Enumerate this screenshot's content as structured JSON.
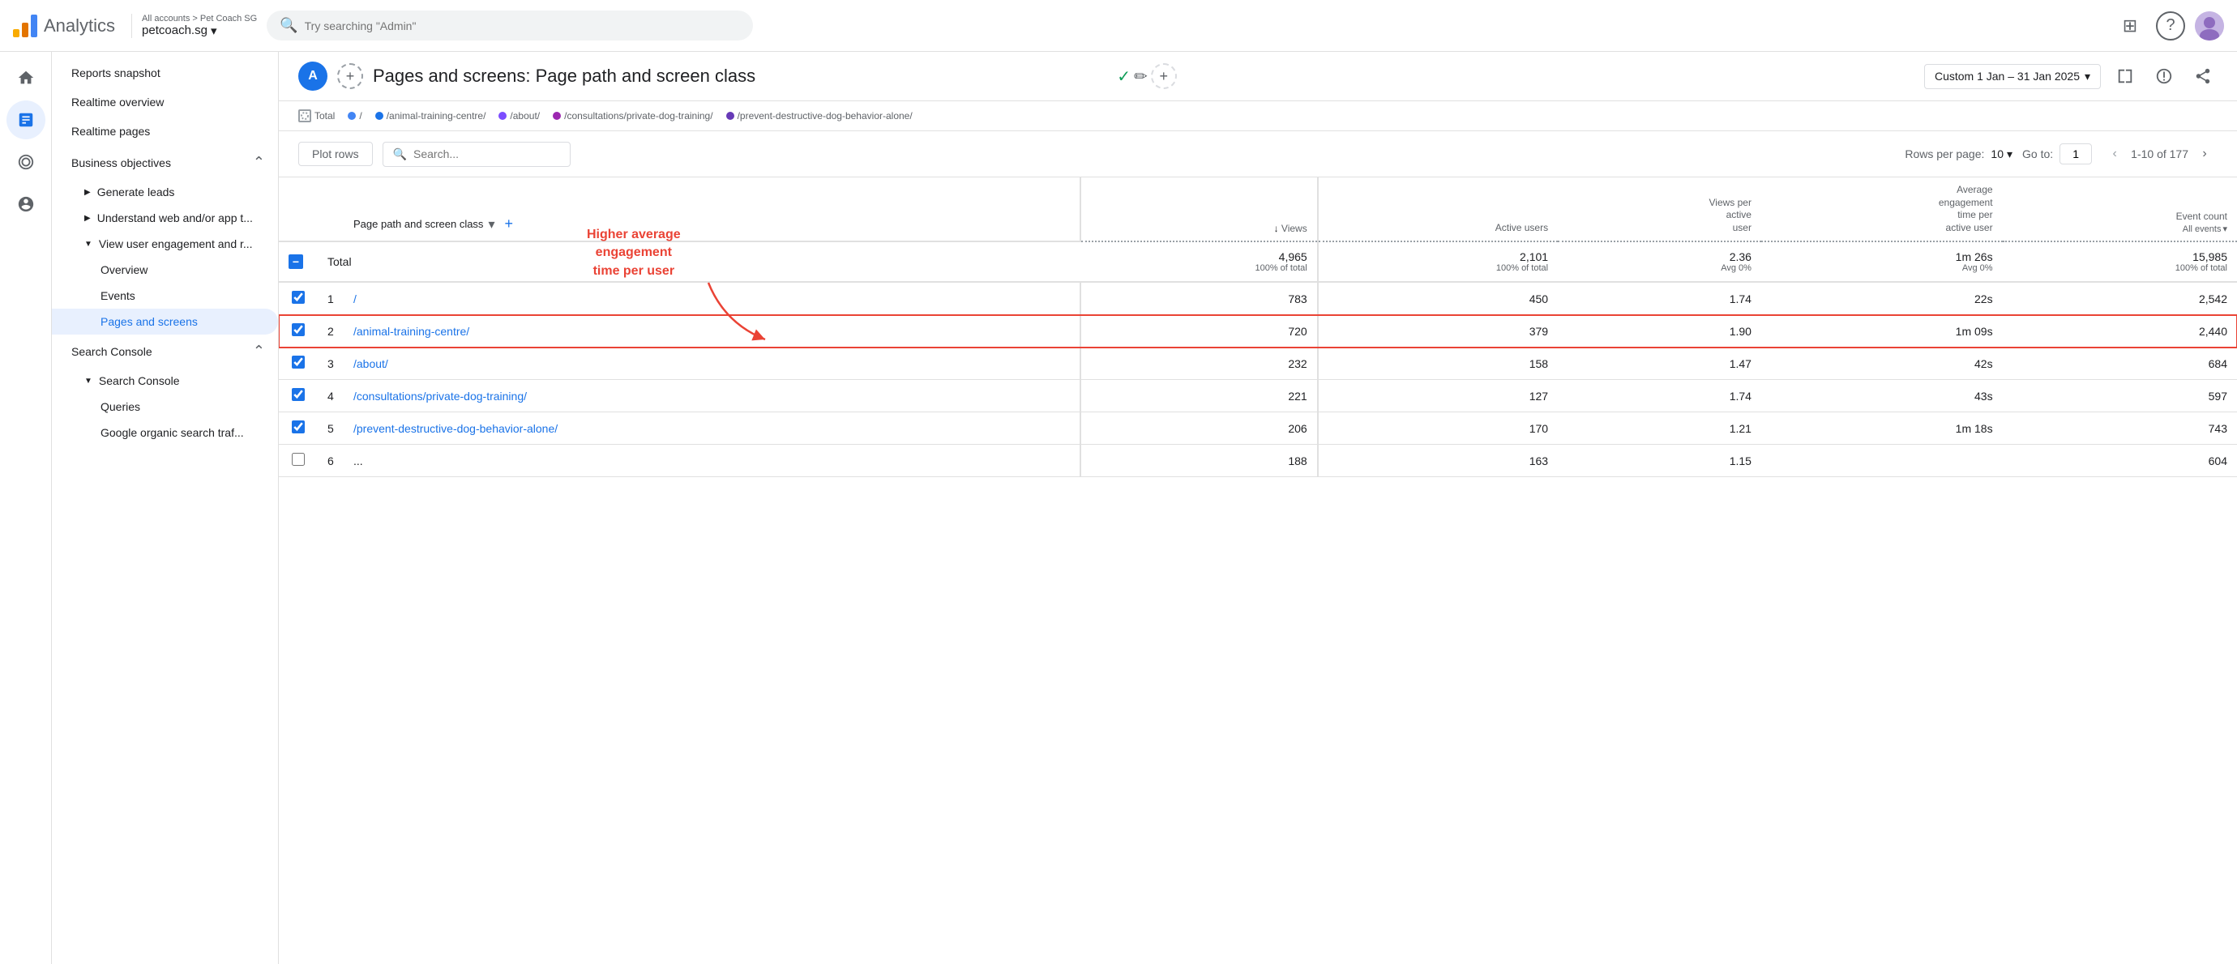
{
  "header": {
    "logo_text": "Analytics",
    "breadcrumb": "All accounts > Pet Coach SG",
    "account_name": "petcoach.sg",
    "search_placeholder": "Try searching \"Admin\"",
    "grid_icon": "⊞",
    "help_icon": "?"
  },
  "nav_icons": [
    {
      "name": "home-icon",
      "symbol": "⌂",
      "active": false
    },
    {
      "name": "reports-icon",
      "symbol": "📊",
      "active": true
    },
    {
      "name": "explore-icon",
      "symbol": "◎",
      "active": false
    },
    {
      "name": "advertising-icon",
      "symbol": "◌",
      "active": false
    }
  ],
  "sidebar": {
    "reports_snapshot_label": "Reports snapshot",
    "realtime_overview_label": "Realtime overview",
    "realtime_pages_label": "Realtime pages",
    "business_objectives_label": "Business objectives",
    "generate_leads_label": "Generate leads",
    "understand_web_label": "Understand web and/or app t...",
    "view_user_engagement_label": "View user engagement and r...",
    "overview_label": "Overview",
    "events_label": "Events",
    "pages_and_screens_label": "Pages and screens",
    "search_console_section_label": "Search Console",
    "search_console_label": "Search Console",
    "queries_label": "Queries",
    "google_organic_label": "Google organic search traf..."
  },
  "page_header": {
    "avatar_letter": "A",
    "title": "Pages and screens: Page path and screen class",
    "date_range": "Custom  1 Jan – 31 Jan 2025",
    "compare_icon": "▥",
    "share_icon": "⬡"
  },
  "chart_legend": {
    "total_label": "Total",
    "items": [
      {
        "color": "#4285f4",
        "label": "/"
      },
      {
        "color": "#1a73e8",
        "label": "/animal-training-centre/"
      },
      {
        "color": "#7c4dff",
        "label": "/about/"
      },
      {
        "color": "#9c27b0",
        "label": "/consultations/private-dog-training/"
      },
      {
        "color": "#673ab7",
        "label": "/prevent-destructive-dog-behavior-alone/"
      }
    ]
  },
  "table_controls": {
    "plot_rows_label": "Plot rows",
    "search_placeholder": "Search...",
    "rows_per_page_label": "Rows per page:",
    "rows_per_page_value": "10",
    "go_to_label": "Go to:",
    "go_to_value": "1",
    "pagination_text": "1-10 of 177"
  },
  "table": {
    "headers": [
      {
        "key": "checkbox",
        "label": ""
      },
      {
        "key": "number",
        "label": ""
      },
      {
        "key": "page_path",
        "label": "Page path and screen class"
      },
      {
        "key": "views",
        "label": "Views",
        "sort": true
      },
      {
        "key": "active_users",
        "label": "Active users"
      },
      {
        "key": "views_per_active_user",
        "label": "Views per active user"
      },
      {
        "key": "avg_engagement_time",
        "label": "Average engagement time per active user"
      },
      {
        "key": "event_count",
        "label": "Event count",
        "sub_label": "All events"
      }
    ],
    "total_row": {
      "label": "Total",
      "views": "4,965",
      "views_sub": "100% of total",
      "active_users": "2,101",
      "active_users_sub": "100% of total",
      "views_per_active_user": "2.36",
      "views_per_active_user_sub": "Avg 0%",
      "avg_engagement_time": "1m 26s",
      "avg_engagement_time_sub": "Avg 0%",
      "event_count": "15,985",
      "event_count_sub": "100% of total"
    },
    "rows": [
      {
        "number": "1",
        "page_path": "/",
        "views": "783",
        "active_users": "450",
        "views_per_active_user": "1.74",
        "avg_engagement_time": "22s",
        "event_count": "2,542",
        "checked": true,
        "highlighted": false
      },
      {
        "number": "2",
        "page_path": "/animal-training-centre/",
        "views": "720",
        "active_users": "379",
        "views_per_active_user": "1.90",
        "avg_engagement_time": "1m 09s",
        "event_count": "2,440",
        "checked": true,
        "highlighted": true
      },
      {
        "number": "3",
        "page_path": "/about/",
        "views": "232",
        "active_users": "158",
        "views_per_active_user": "1.47",
        "avg_engagement_time": "42s",
        "event_count": "684",
        "checked": true,
        "highlighted": false
      },
      {
        "number": "4",
        "page_path": "/consultations/private-dog-training/",
        "views": "221",
        "active_users": "127",
        "views_per_active_user": "1.74",
        "avg_engagement_time": "43s",
        "event_count": "597",
        "checked": true,
        "highlighted": false
      },
      {
        "number": "5",
        "page_path": "/prevent-destructive-dog-behavior-alone/",
        "views": "206",
        "active_users": "170",
        "views_per_active_user": "1.21",
        "avg_engagement_time": "1m 18s",
        "event_count": "743",
        "checked": true,
        "highlighted": false
      },
      {
        "number": "6",
        "page_path": "",
        "views": "188",
        "active_users": "163",
        "views_per_active_user": "1.15",
        "avg_engagement_time": "",
        "event_count": "604",
        "checked": false,
        "highlighted": false,
        "truncated": true
      }
    ]
  },
  "annotation": {
    "text": "Higher average\nengagement\ntime per user",
    "color": "#ea4335"
  },
  "colors": {
    "primary_blue": "#1a73e8",
    "highlight_red": "#ea4335",
    "active_blue_bg": "#e8f0fe",
    "border": "#e0e0e0",
    "text_secondary": "#5f6368"
  }
}
